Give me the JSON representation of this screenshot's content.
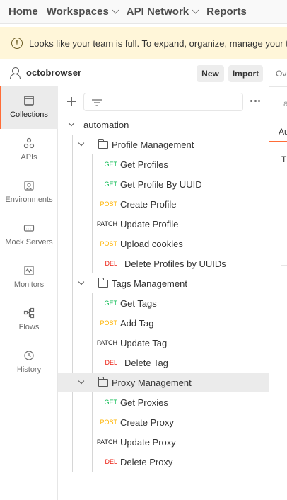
{
  "topnav": {
    "items": [
      {
        "label": "Home",
        "has_dropdown": false
      },
      {
        "label": "Workspaces",
        "has_dropdown": true
      },
      {
        "label": "API Network",
        "has_dropdown": true
      },
      {
        "label": "Reports",
        "has_dropdown": false
      }
    ]
  },
  "banner": {
    "icon": "info-icon",
    "message": "Looks like your team is full. To expand, organize, manage your te"
  },
  "workspace": {
    "name": "octobrowser",
    "new_label": "New",
    "import_label": "Import"
  },
  "sidebar": {
    "items": [
      {
        "label": "Collections",
        "icon": "collections-icon",
        "active": true
      },
      {
        "label": "APIs",
        "icon": "apis-icon",
        "active": false
      },
      {
        "label": "Environments",
        "icon": "environments-icon",
        "active": false
      },
      {
        "label": "Mock Servers",
        "icon": "mock-servers-icon",
        "active": false
      },
      {
        "label": "Monitors",
        "icon": "monitors-icon",
        "active": false
      },
      {
        "label": "Flows",
        "icon": "flows-icon",
        "active": false
      },
      {
        "label": "History",
        "icon": "history-icon",
        "active": false
      }
    ]
  },
  "collections": {
    "root": "automation",
    "folders": [
      {
        "name": "Profile Management",
        "requests": [
          {
            "method": "GET",
            "name": "Get Profiles"
          },
          {
            "method": "GET",
            "name": "Get Profile By UUID"
          },
          {
            "method": "POST",
            "name": "Create Profile"
          },
          {
            "method": "PATCH",
            "name": "Update Profile"
          },
          {
            "method": "POST",
            "name": "Upload cookies"
          },
          {
            "method": "DEL",
            "name": "Delete Profiles by UUIDs"
          }
        ]
      },
      {
        "name": "Tags Management",
        "requests": [
          {
            "method": "GET",
            "name": "Get Tags"
          },
          {
            "method": "POST",
            "name": "Add Tag"
          },
          {
            "method": "PATCH",
            "name": "Update Tag"
          },
          {
            "method": "DEL",
            "name": "Delete Tag"
          }
        ]
      },
      {
        "name": "Proxy Management",
        "highlighted": true,
        "requests": [
          {
            "method": "GET",
            "name": "Get Proxies"
          },
          {
            "method": "POST",
            "name": "Create Proxy"
          },
          {
            "method": "PATCH",
            "name": "Update Proxy"
          },
          {
            "method": "DEL",
            "name": "Delete Proxy"
          }
        ]
      }
    ]
  },
  "right_pane": {
    "tab": "Ove",
    "input_text": "a",
    "active_tab": "Au",
    "body_text": "Th"
  },
  "colors": {
    "accent": "#ff6c37",
    "get": "#0cbb52",
    "post": "#ffb400",
    "delete": "#eb2013",
    "banner_bg": "#fff6d9"
  }
}
